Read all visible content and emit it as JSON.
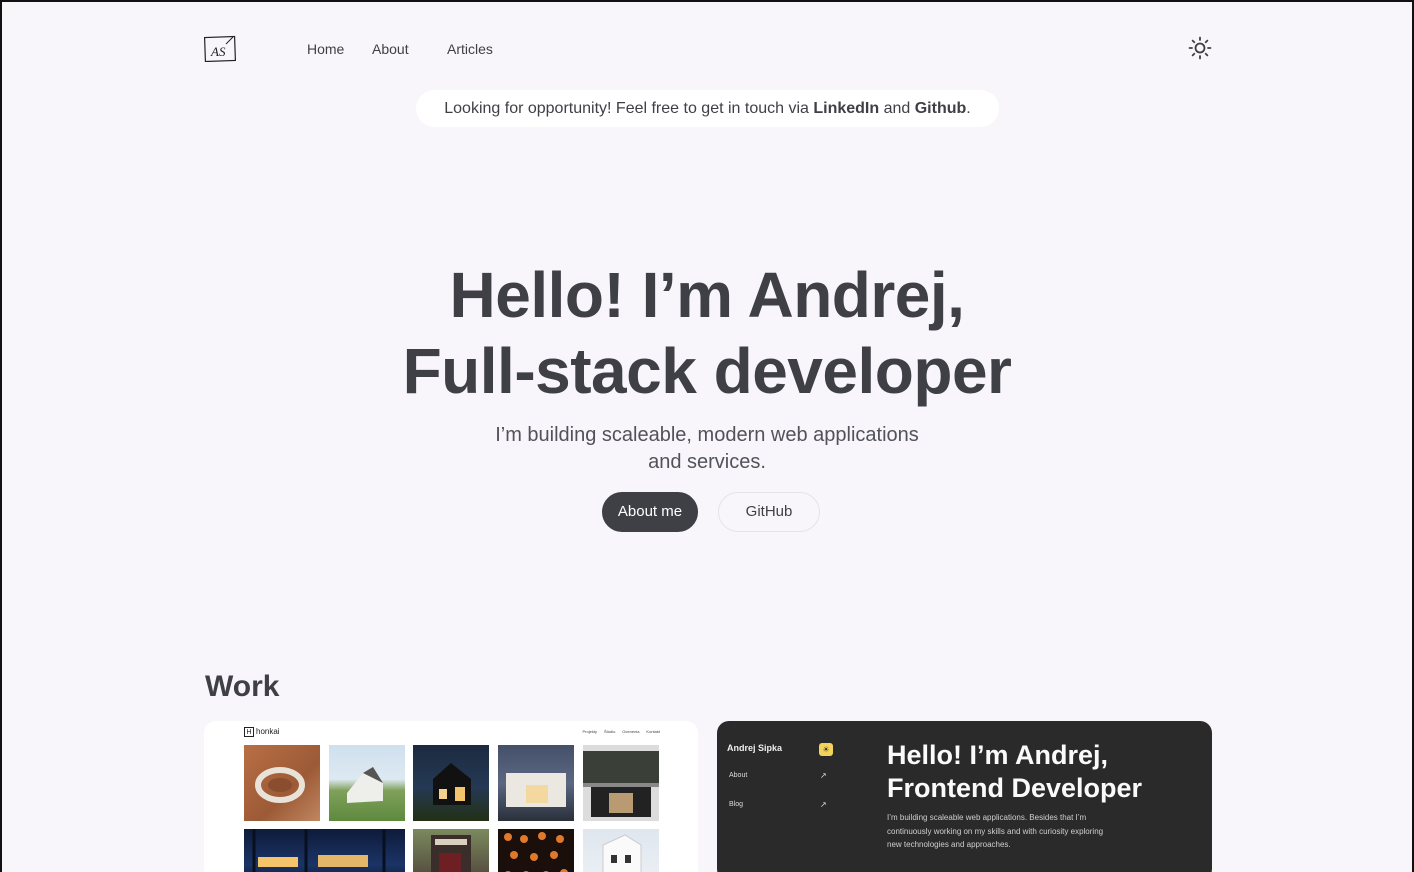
{
  "nav": {
    "logo_text": "AS",
    "links": [
      "Home",
      "About",
      "Articles"
    ],
    "theme_icon": "sun-icon"
  },
  "banner": {
    "prefix": "Looking for opportunity! Feel free to get in touch via ",
    "linkedin": "LinkedIn",
    "middle": " and ",
    "github": "Github",
    "suffix": "."
  },
  "hero": {
    "title_line1": "Hello! I’m Andrej,",
    "title_line2": "Full-stack developer",
    "subtitle_line1": "I’m building scaleable, modern web applications",
    "subtitle_line2": "and services.",
    "primary_button": "About me",
    "secondary_button": "GitHub"
  },
  "work": {
    "title": "Work",
    "card1": {
      "brand": "honkai",
      "brand_box": "H",
      "nav": [
        "Projekty",
        "Štúdio",
        "Ocenenia",
        "Kontakt"
      ]
    },
    "card2": {
      "name": "Andrej Sipka",
      "links": [
        "About",
        "Blog"
      ],
      "title_line1": "Hello! I’m Andrej,",
      "title_line2": "Frontend Developer",
      "subtitle": "I’m building scaleable web applications. Besides that I’m continuously working on my skills and with curiosity exploring new technologies and approaches."
    }
  },
  "colors": {
    "background": "#f8f6fa",
    "text": "#3f3f46",
    "primary_button": "#3f3f46",
    "dark_card": "#2a2a2a",
    "accent_yellow": "#f3d35b"
  }
}
